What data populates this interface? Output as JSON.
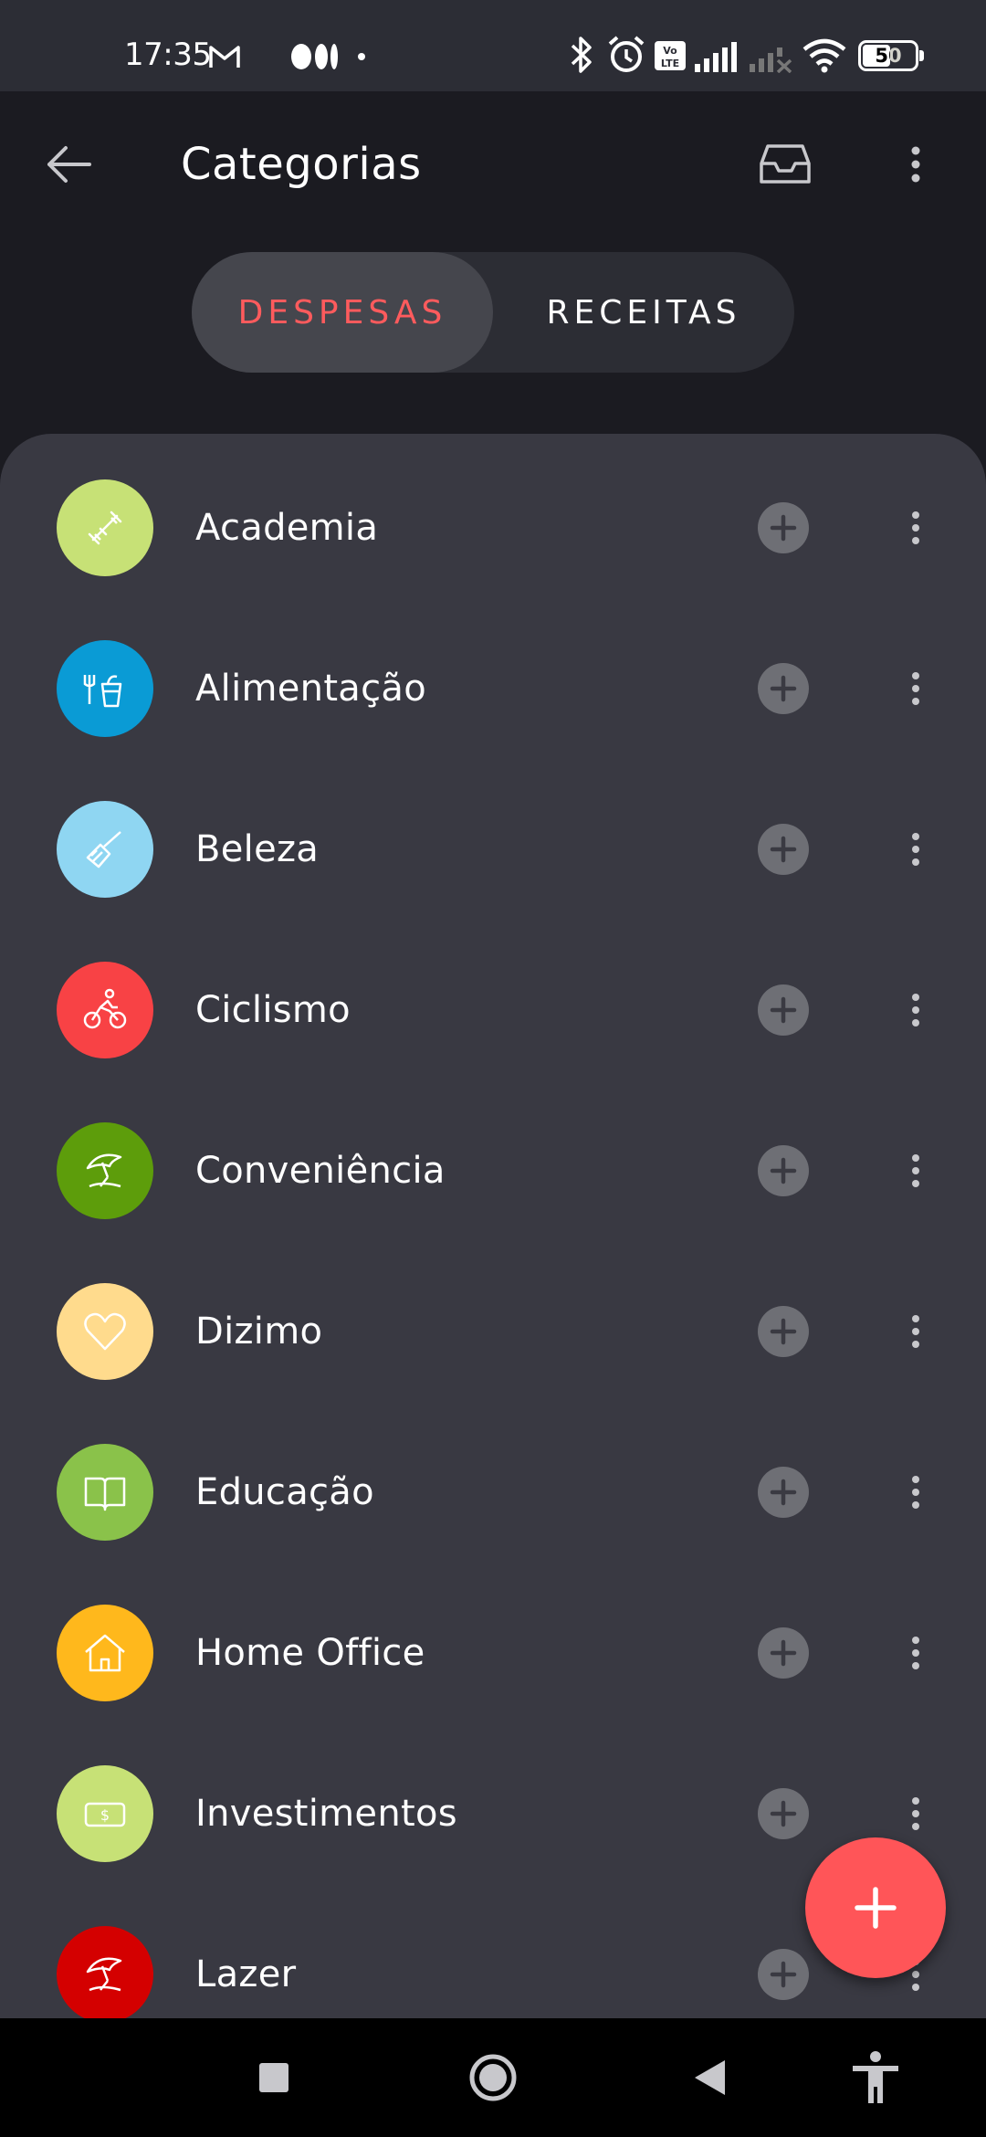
{
  "status_bar": {
    "time": "17:35",
    "battery": "50",
    "icons": [
      "gmail-icon",
      "media-icon",
      "dot-icon",
      "bluetooth-icon",
      "alarm-icon",
      "volte-icon",
      "signal-icon",
      "signal-off-icon",
      "wifi-icon",
      "battery-icon"
    ]
  },
  "app_bar": {
    "title": "Categorias",
    "back_icon": "arrow-left-icon",
    "archive_icon": "inbox-icon",
    "menu_icon": "more-vert-icon"
  },
  "tabs": [
    {
      "label": "DESPESAS",
      "selected": true
    },
    {
      "label": "RECEITAS",
      "selected": false
    }
  ],
  "colors": {
    "accent": "#ff5558",
    "background": "#1b1b21",
    "sheet": "#393942"
  },
  "categories": [
    {
      "label": "Academia",
      "color": "#c7e176",
      "icon": "dumbbell-icon"
    },
    {
      "label": "Alimentação",
      "color": "#0a9bd5",
      "icon": "fork-cup-icon"
    },
    {
      "label": "Beleza",
      "color": "#8fd6f2",
      "icon": "brush-icon"
    },
    {
      "label": "Ciclismo",
      "color": "#f84245",
      "icon": "cyclist-icon"
    },
    {
      "label": "Conveniência",
      "color": "#5d9d0b",
      "icon": "umbrella-icon"
    },
    {
      "label": "Dizimo",
      "color": "#ffdb8d",
      "icon": "heart-icon"
    },
    {
      "label": "Educação",
      "color": "#8ac24a",
      "icon": "book-icon"
    },
    {
      "label": "Home Office",
      "color": "#ffb81c",
      "icon": "house-icon"
    },
    {
      "label": "Investimentos",
      "color": "#c7e176",
      "icon": "money-icon"
    },
    {
      "label": "Lazer",
      "color": "#d40000",
      "icon": "umbrella-icon"
    }
  ],
  "fab": {
    "icon": "plus-icon"
  },
  "nav_bar": {
    "icons": [
      "recents-square-icon",
      "home-circle-icon",
      "back-triangle-icon",
      "accessibility-icon"
    ]
  }
}
